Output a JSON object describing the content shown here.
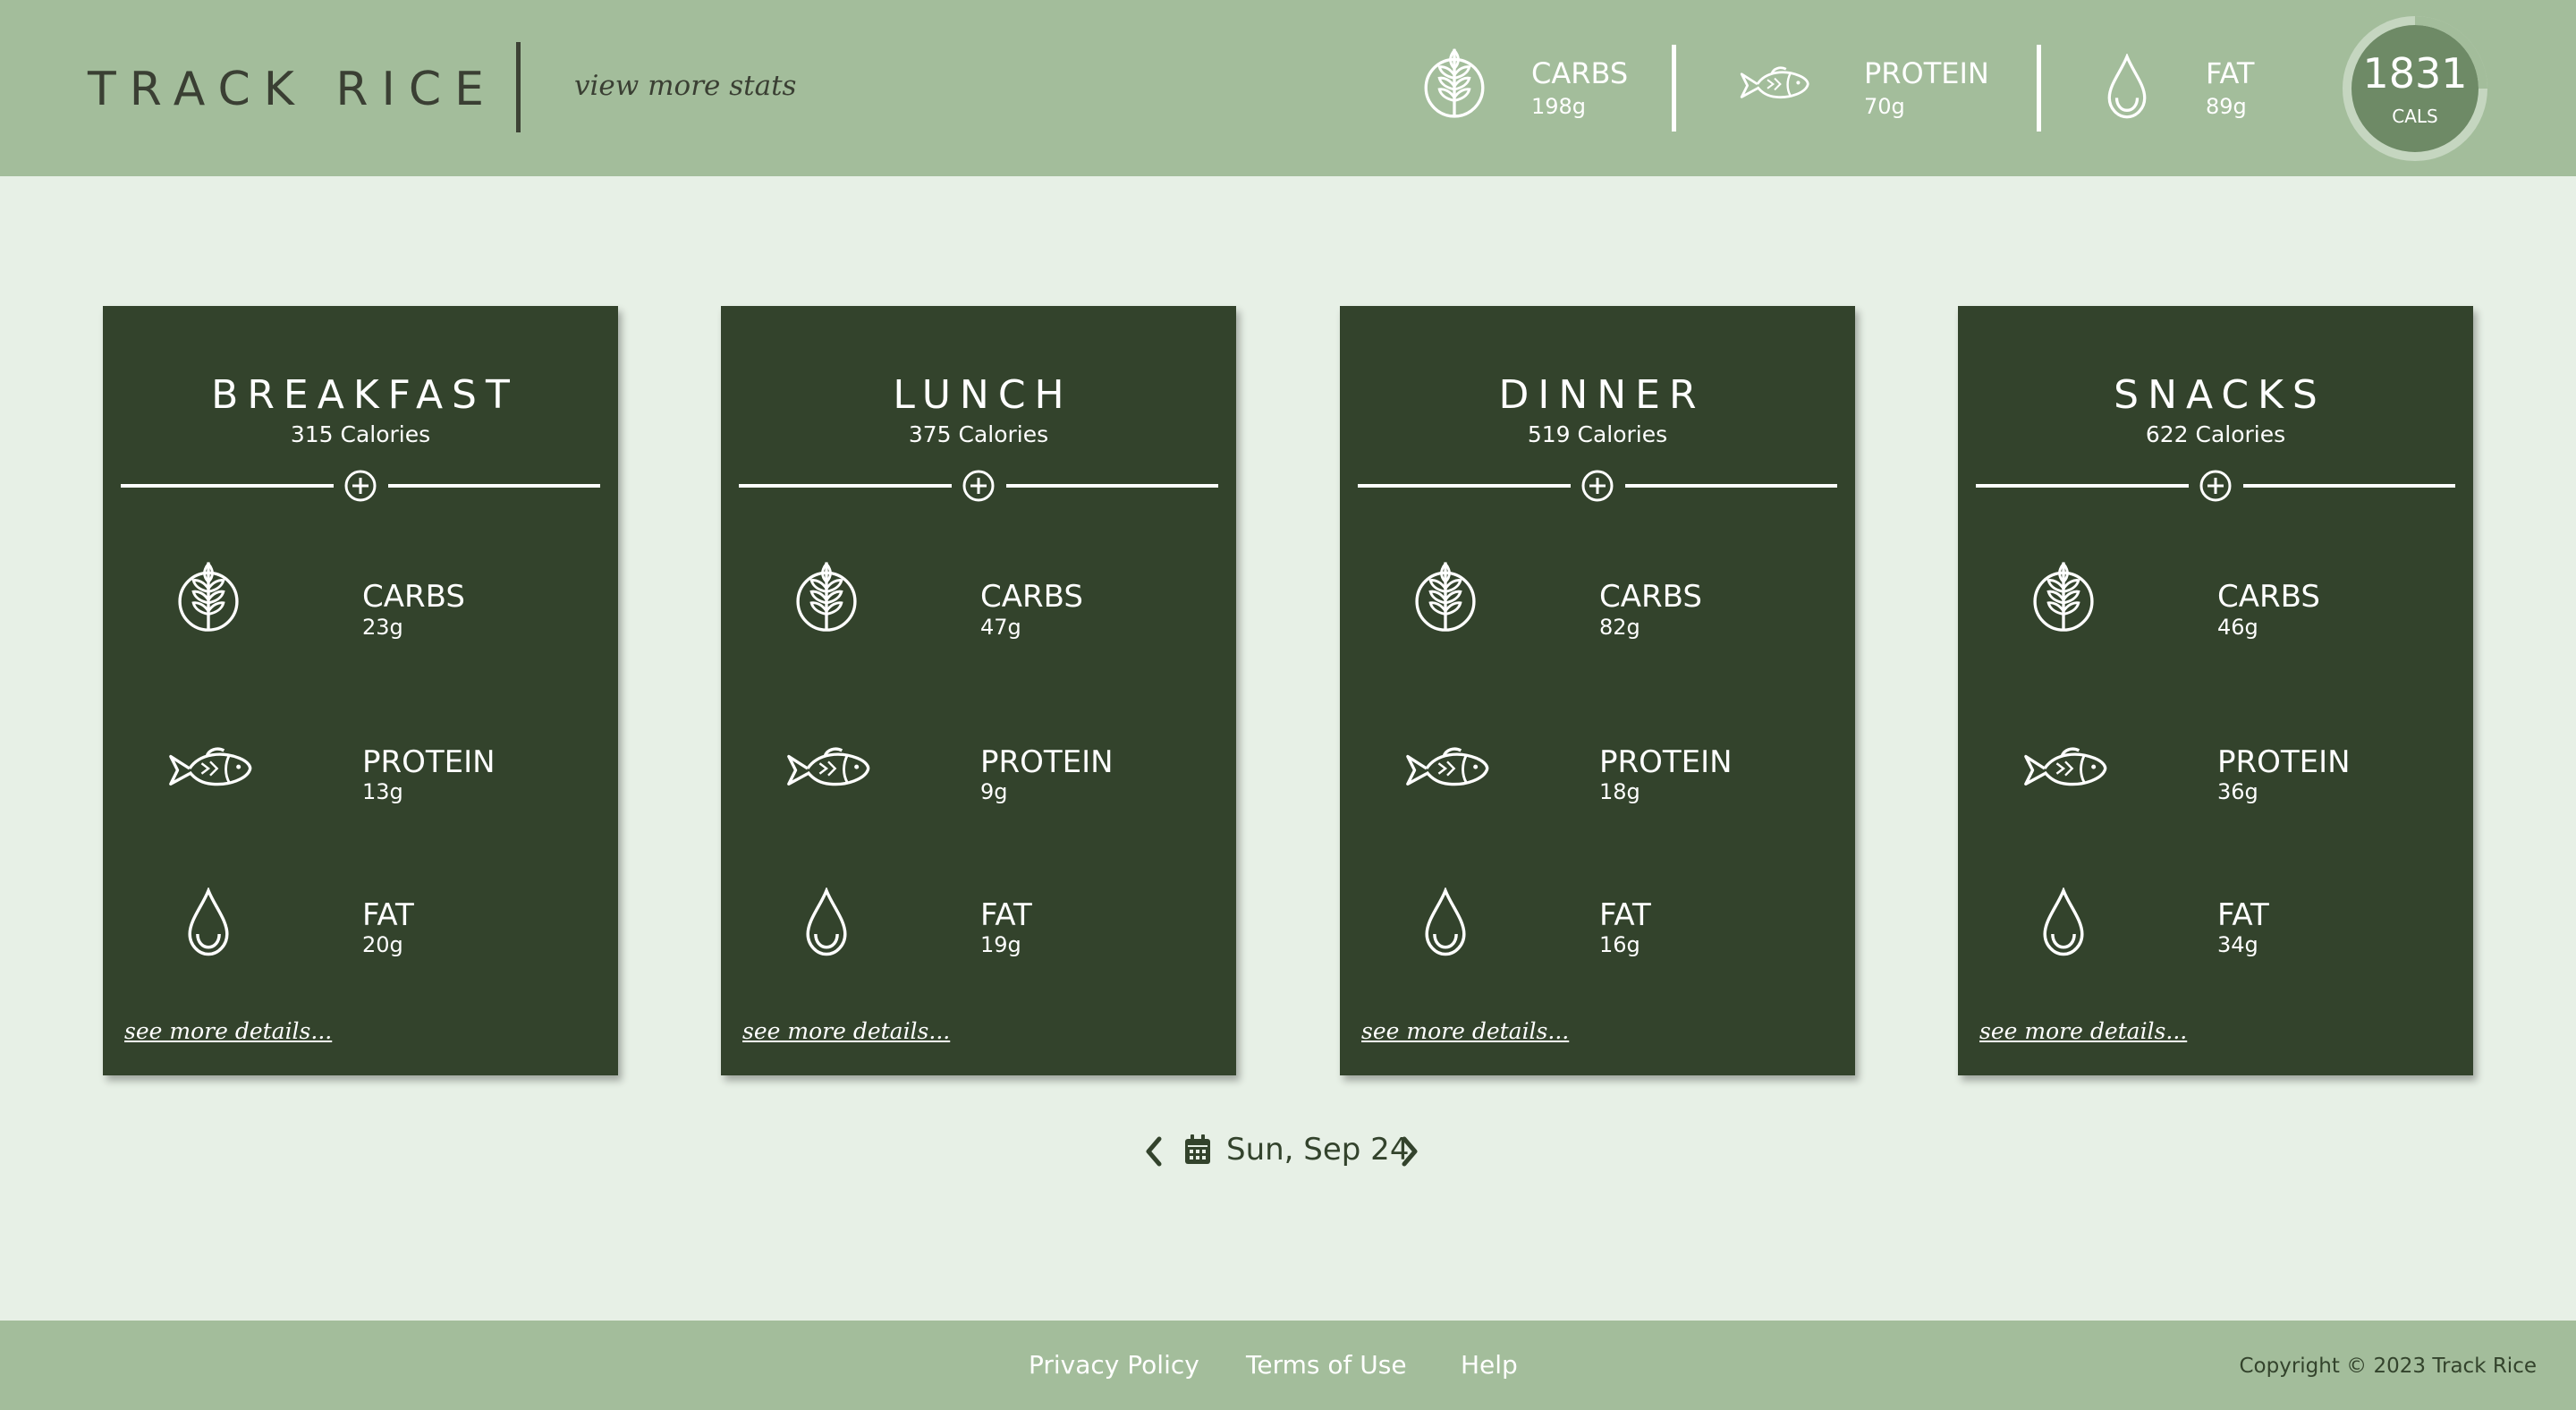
{
  "header": {
    "logo": "TRACK RICE",
    "view_stats": "view more stats",
    "totals": {
      "carbs_label": "CARBS",
      "carbs_value": "198g",
      "protein_label": "PROTEIN",
      "protein_value": "70g",
      "fat_label": "FAT",
      "fat_value": "89g",
      "calories_value": "1831",
      "calories_label": "CALS"
    }
  },
  "meals": [
    {
      "title": "BREAKFAST",
      "calories": "315 Calories",
      "carbs_label": "CARBS",
      "carbs": "23g",
      "protein_label": "PROTEIN",
      "protein": "13g",
      "fat_label": "FAT",
      "fat": "20g",
      "details": "see more details..."
    },
    {
      "title": "LUNCH",
      "calories": "375 Calories",
      "carbs_label": "CARBS",
      "carbs": "47g",
      "protein_label": "PROTEIN",
      "protein": "9g",
      "fat_label": "FAT",
      "fat": "19g",
      "details": "see more details..."
    },
    {
      "title": "DINNER",
      "calories": "519 Calories",
      "carbs_label": "CARBS",
      "carbs": "82g",
      "protein_label": "PROTEIN",
      "protein": "18g",
      "fat_label": "FAT",
      "fat": "16g",
      "details": "see more details..."
    },
    {
      "title": "SNACKS",
      "calories": "622 Calories",
      "carbs_label": "CARBS",
      "carbs": "46g",
      "protein_label": "PROTEIN",
      "protein": "36g",
      "fat_label": "FAT",
      "fat": "34g",
      "details": "see more details..."
    }
  ],
  "date_nav": {
    "date": "Sun, Sep 24",
    "prev_icon": "chevron-left-icon",
    "next_icon": "chevron-right-icon",
    "calendar_icon": "calendar-icon"
  },
  "footer": {
    "links": [
      "Privacy Policy",
      "Terms of Use",
      "Help"
    ],
    "copyright": "Copyright © 2023 Track Rice"
  },
  "colors": {
    "header_bg": "#a3bd9b",
    "page_bg": "#e7f0e6",
    "card_bg": "#33432c",
    "text_dark": "#3a3f33"
  }
}
